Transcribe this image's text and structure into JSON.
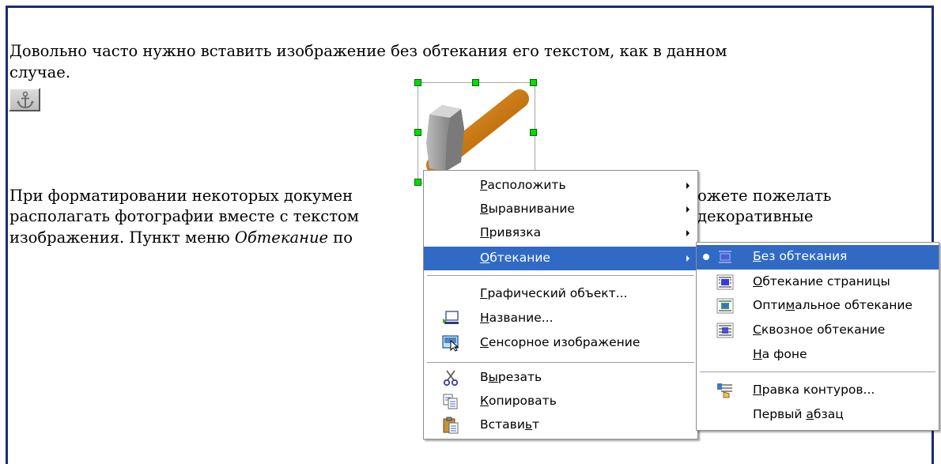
{
  "document": {
    "line1": "Довольно часто нужно вставить изображение без обтекания его текстом, как в данном",
    "line2": "случае.",
    "line3a": "При форматировании некоторых докумен",
    "line3b": "ожете пожелать",
    "line4a": "располагать фотографии вместе с текстом",
    "line4b": "декоративные",
    "line5a": "изображения. Пункт меню ",
    "line5_italic": "Обтекание",
    "line5b": " по"
  },
  "context_menu": {
    "items": [
      {
        "label": "Расположить",
        "mnemonic": "Р",
        "submenu": true
      },
      {
        "label": "Выравнивание",
        "mnemonic": "В",
        "submenu": true
      },
      {
        "label": "Привязка",
        "mnemonic": "П",
        "submenu": true
      },
      {
        "label": "Обтекание",
        "mnemonic": "О",
        "submenu": true,
        "highlighted": true
      },
      {
        "label": "Графический объект...",
        "mnemonic": "Г"
      },
      {
        "label": "Название...",
        "mnemonic": "Н",
        "icon": "caption-icon"
      },
      {
        "label": "Сенсорное изображение",
        "mnemonic": "С",
        "icon": "image-map-icon"
      },
      {
        "label": "Вырезать",
        "mnemonic": "ы",
        "icon": "scissors-icon"
      },
      {
        "label": "Копировать",
        "mnemonic": "К",
        "icon": "copy-icon"
      },
      {
        "label": "Вставить",
        "mnemonic": "ь",
        "icon": "paste-icon"
      }
    ]
  },
  "wrap_submenu": {
    "items": [
      {
        "label": "Без обтекания",
        "mnemonic": "Б",
        "checked": true,
        "highlighted": true,
        "icon": "wrap-off-icon"
      },
      {
        "label": "Обтекание страницы",
        "mnemonic": "О",
        "icon": "wrap-page-icon"
      },
      {
        "label": "Оптимальное обтекание",
        "mnemonic": "м",
        "icon": "wrap-optimal-icon"
      },
      {
        "label": "Сквозное обтекание",
        "mnemonic": "С",
        "icon": "wrap-through-icon"
      },
      {
        "label": "На фоне",
        "mnemonic": "Н"
      },
      {
        "label": "Правка контуров...",
        "mnemonic": "П",
        "icon": "edit-contour-icon"
      },
      {
        "label": "Первый абзац",
        "mnemonic": "а"
      }
    ]
  },
  "colors": {
    "highlight": "#316ac5",
    "frame": "#1c2a7a",
    "handle": "#00dd00",
    "hammer_handle": "#c97a12"
  }
}
